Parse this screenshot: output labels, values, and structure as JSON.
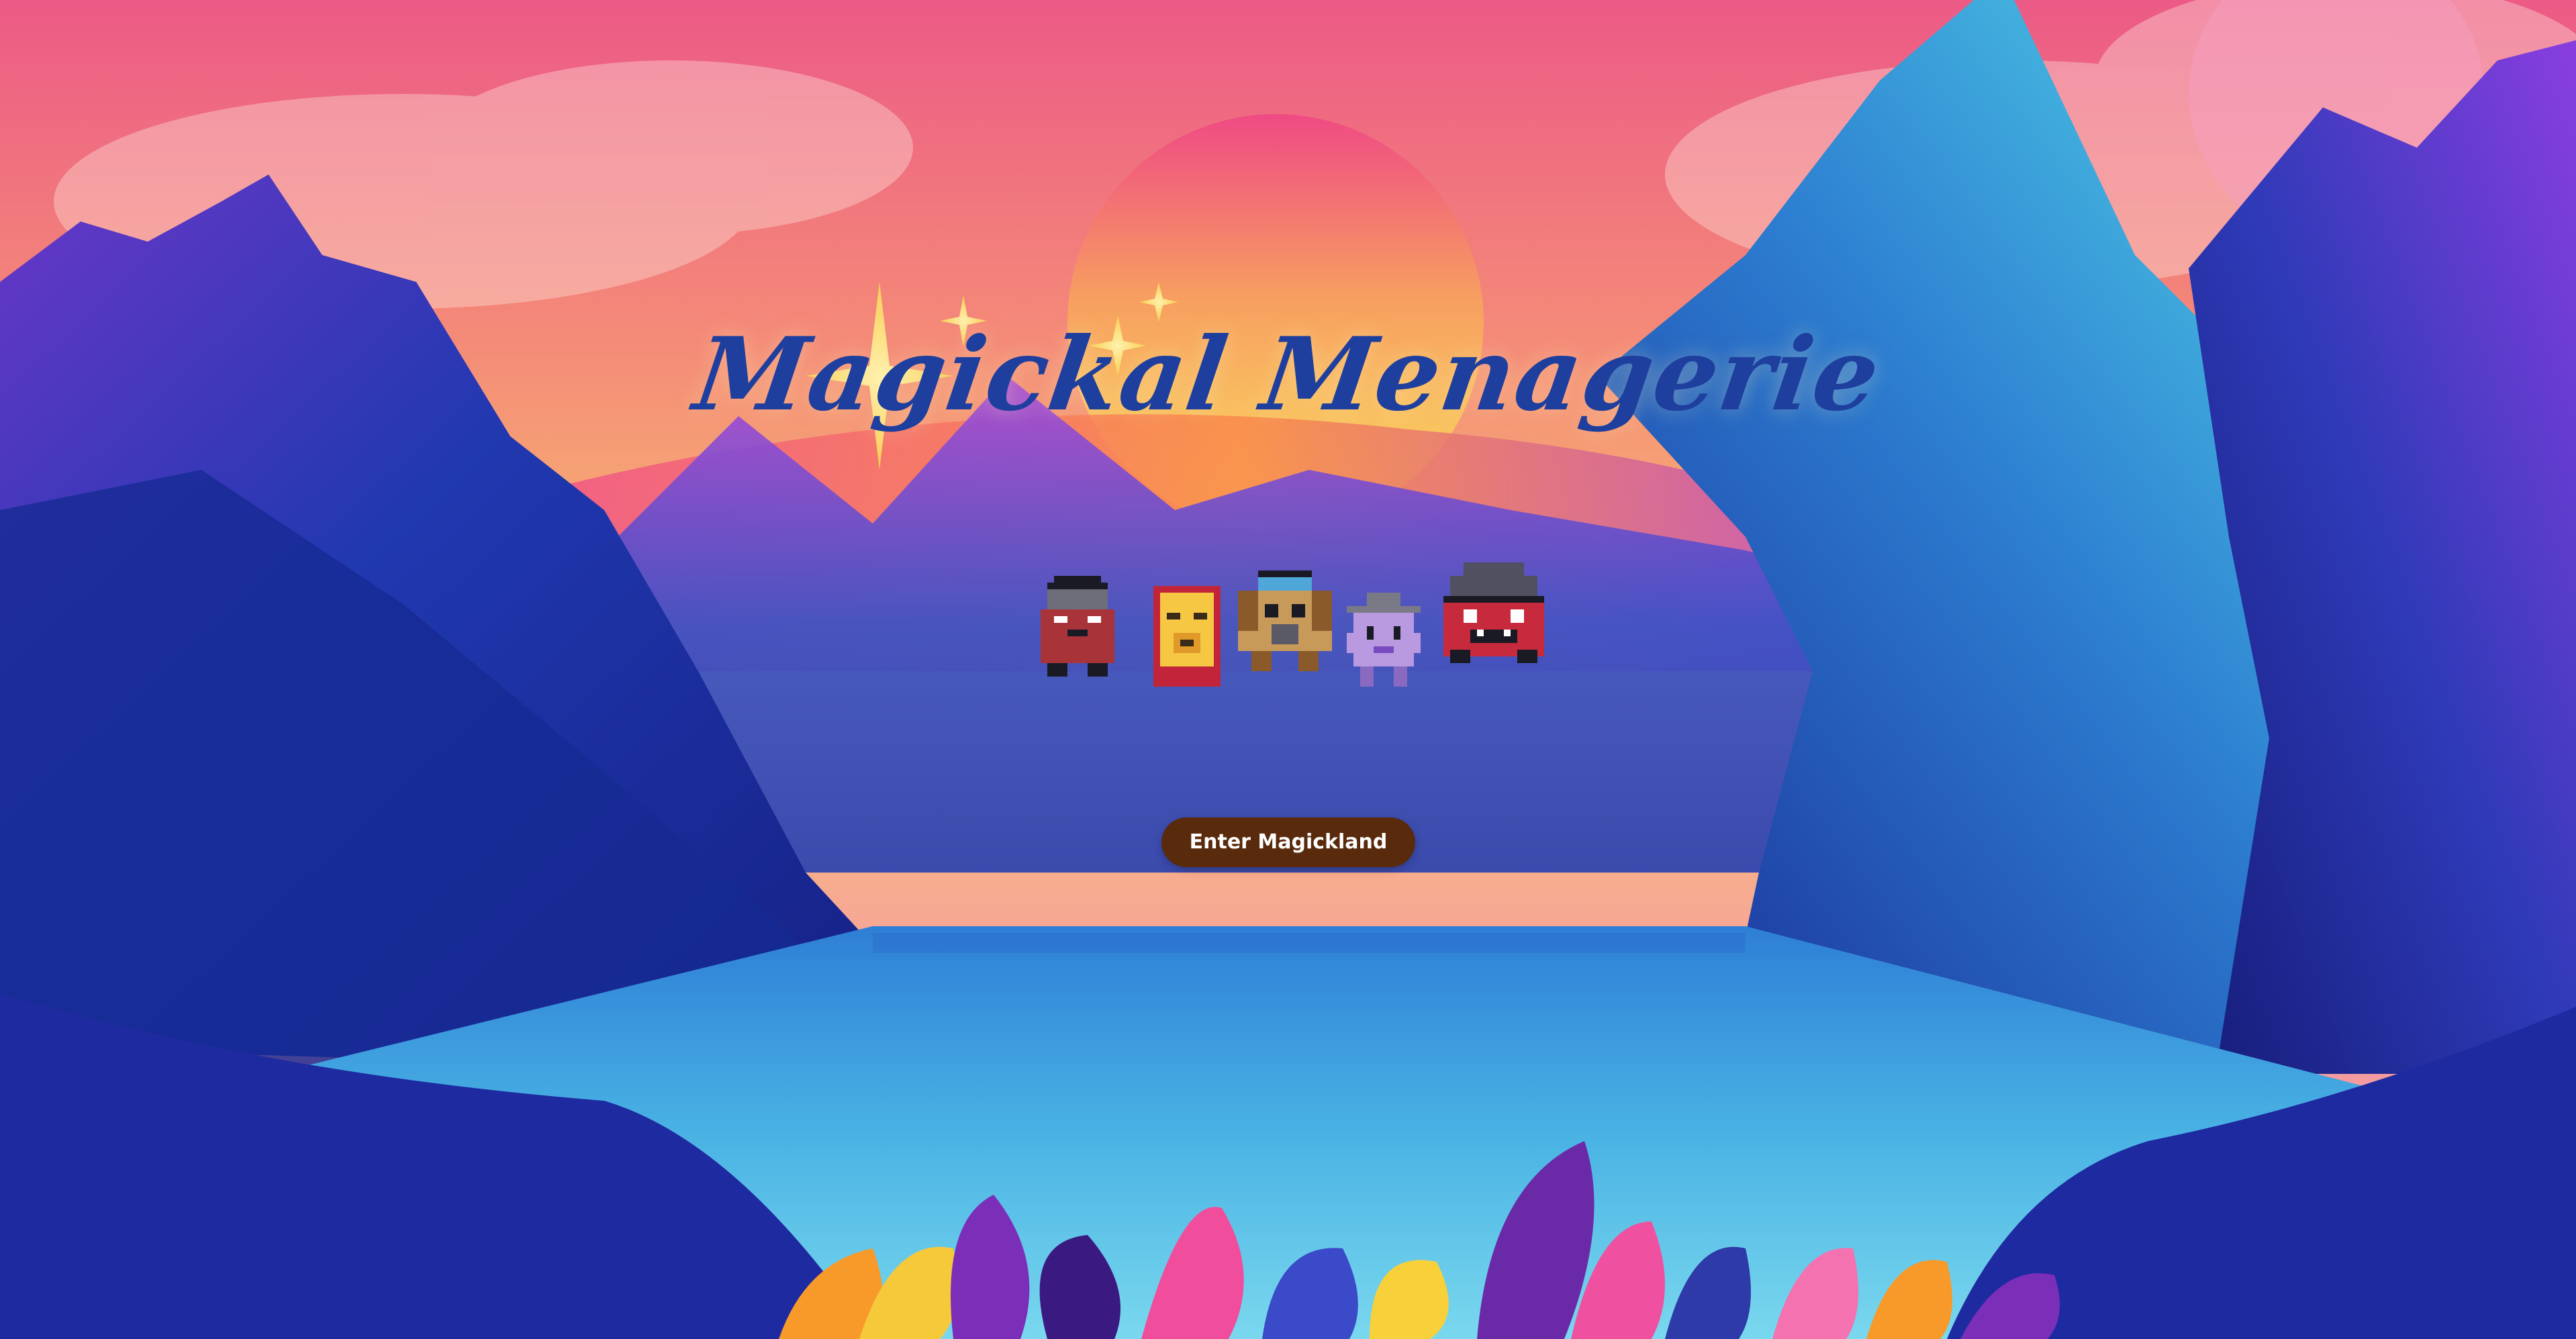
{
  "hero": {
    "title": "Magickal Menagerie",
    "enter_button_label": "Enter Magickland"
  },
  "characters": [
    {
      "name": "grey-hooded-critter",
      "colors": {
        "body": "#a8343a",
        "head": "#6e6e7a"
      }
    },
    {
      "name": "yellow-scroll-critter",
      "colors": {
        "body": "#f5c742",
        "frame": "#c2253a"
      }
    },
    {
      "name": "tan-dog-critter",
      "colors": {
        "body": "#c89a5a",
        "hat": "#4fa6d8"
      }
    },
    {
      "name": "purple-hat-critter",
      "colors": {
        "body": "#b99ae0",
        "hat": "#7a7a86"
      }
    },
    {
      "name": "red-spiky-critter",
      "colors": {
        "body": "#c62a3c",
        "shell": "#505060"
      }
    }
  ],
  "colors": {
    "title": "#1e3f9e",
    "button_bg": "#5a2a0c",
    "button_text": "#ffffff",
    "sky_top": "#f06a8a",
    "sun": "#f7d24a",
    "mountain_dark": "#1d2f9a",
    "lake": "#5ec3e6"
  }
}
